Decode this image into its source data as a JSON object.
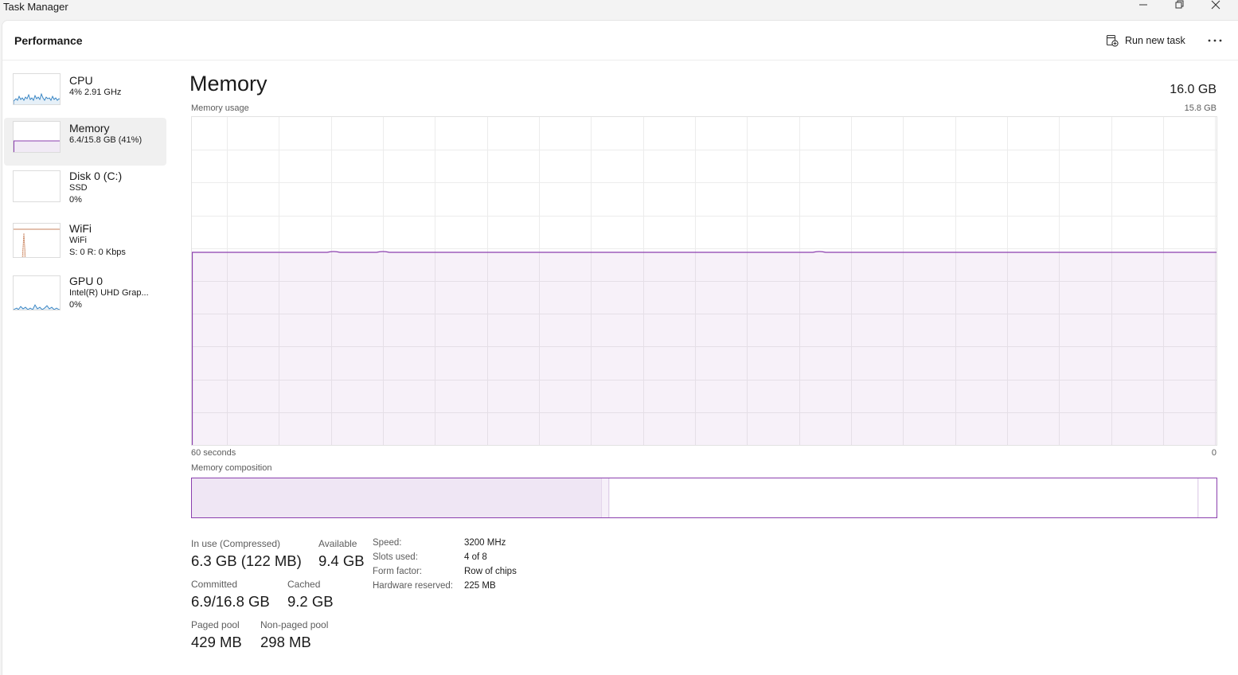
{
  "window": {
    "title": "Task Manager",
    "controls": [
      "minimize",
      "maximize",
      "close"
    ]
  },
  "header": {
    "page_title": "Performance",
    "run_new_task": "Run new task",
    "more_icon": "more-icon"
  },
  "sidebar": {
    "items": [
      {
        "name": "CPU",
        "line1": "4% 2.91 GHz",
        "line2": "",
        "color": "#2e7fc1"
      },
      {
        "name": "Memory",
        "line1": "6.4/15.8 GB (41%)",
        "line2": "",
        "color": "#8b3fae",
        "active": true
      },
      {
        "name": "Disk 0 (C:)",
        "line1": "SSD",
        "line2": "0%",
        "color": "#4a9a2c"
      },
      {
        "name": "WiFi",
        "line1": "WiFi",
        "line2": "S: 0 R: 0 Kbps",
        "color": "#b55a2a"
      },
      {
        "name": "GPU 0",
        "line1": "Intel(R) UHD Grap...",
        "line2": "0%",
        "color": "#2e7fc1"
      }
    ]
  },
  "memory": {
    "title": "Memory",
    "total": "16.0 GB",
    "usage_label": "Memory usage",
    "usage_max": "15.8 GB",
    "time_left": "60 seconds",
    "time_right": "0",
    "composition_label": "Memory composition",
    "accent_color": "#8b3fae",
    "usage_fraction": 0.41,
    "composition": {
      "in_use_fraction": 0.4,
      "modified_fraction": 0.007,
      "standby_fraction": 0.575,
      "free_fraction": 0.016
    }
  },
  "stats": {
    "in_use_label": "In use (Compressed)",
    "in_use_value": "6.3 GB (122 MB)",
    "available_label": "Available",
    "available_value": "9.4 GB",
    "committed_label": "Committed",
    "committed_value": "6.9/16.8 GB",
    "cached_label": "Cached",
    "cached_value": "9.2 GB",
    "paged_label": "Paged pool",
    "paged_value": "429 MB",
    "nonpaged_label": "Non-paged pool",
    "nonpaged_value": "298 MB"
  },
  "details": [
    {
      "key": "Speed:",
      "value": "3200 MHz"
    },
    {
      "key": "Slots used:",
      "value": "4 of 8"
    },
    {
      "key": "Form factor:",
      "value": "Row of chips"
    },
    {
      "key": "Hardware reserved:",
      "value": "225 MB"
    }
  ]
}
